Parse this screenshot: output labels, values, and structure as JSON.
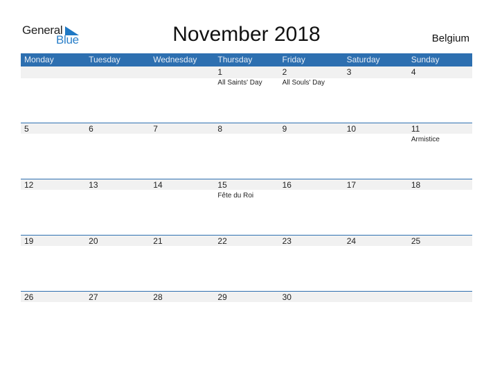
{
  "logo": {
    "line1": "General",
    "line2": "Blue",
    "accent_color": "#1f78c4"
  },
  "title": "November 2018",
  "country": "Belgium",
  "colors": {
    "header_bg": "#2d6fb0",
    "band_bg": "#f1f1f1"
  },
  "weekdays": [
    "Monday",
    "Tuesday",
    "Wednesday",
    "Thursday",
    "Friday",
    "Saturday",
    "Sunday"
  ],
  "weeks": [
    {
      "days": [
        {
          "num": "",
          "holiday": ""
        },
        {
          "num": "",
          "holiday": ""
        },
        {
          "num": "",
          "holiday": ""
        },
        {
          "num": "1",
          "holiday": "All Saints' Day"
        },
        {
          "num": "2",
          "holiday": "All Souls' Day"
        },
        {
          "num": "3",
          "holiday": ""
        },
        {
          "num": "4",
          "holiday": ""
        }
      ]
    },
    {
      "days": [
        {
          "num": "5",
          "holiday": ""
        },
        {
          "num": "6",
          "holiday": ""
        },
        {
          "num": "7",
          "holiday": ""
        },
        {
          "num": "8",
          "holiday": ""
        },
        {
          "num": "9",
          "holiday": ""
        },
        {
          "num": "10",
          "holiday": ""
        },
        {
          "num": "11",
          "holiday": "Armistice"
        }
      ]
    },
    {
      "days": [
        {
          "num": "12",
          "holiday": ""
        },
        {
          "num": "13",
          "holiday": ""
        },
        {
          "num": "14",
          "holiday": ""
        },
        {
          "num": "15",
          "holiday": "Fête du Roi"
        },
        {
          "num": "16",
          "holiday": ""
        },
        {
          "num": "17",
          "holiday": ""
        },
        {
          "num": "18",
          "holiday": ""
        }
      ]
    },
    {
      "days": [
        {
          "num": "19",
          "holiday": ""
        },
        {
          "num": "20",
          "holiday": ""
        },
        {
          "num": "21",
          "holiday": ""
        },
        {
          "num": "22",
          "holiday": ""
        },
        {
          "num": "23",
          "holiday": ""
        },
        {
          "num": "24",
          "holiday": ""
        },
        {
          "num": "25",
          "holiday": ""
        }
      ]
    },
    {
      "days": [
        {
          "num": "26",
          "holiday": ""
        },
        {
          "num": "27",
          "holiday": ""
        },
        {
          "num": "28",
          "holiday": ""
        },
        {
          "num": "29",
          "holiday": ""
        },
        {
          "num": "30",
          "holiday": ""
        },
        {
          "num": "",
          "holiday": ""
        },
        {
          "num": "",
          "holiday": ""
        }
      ]
    }
  ]
}
